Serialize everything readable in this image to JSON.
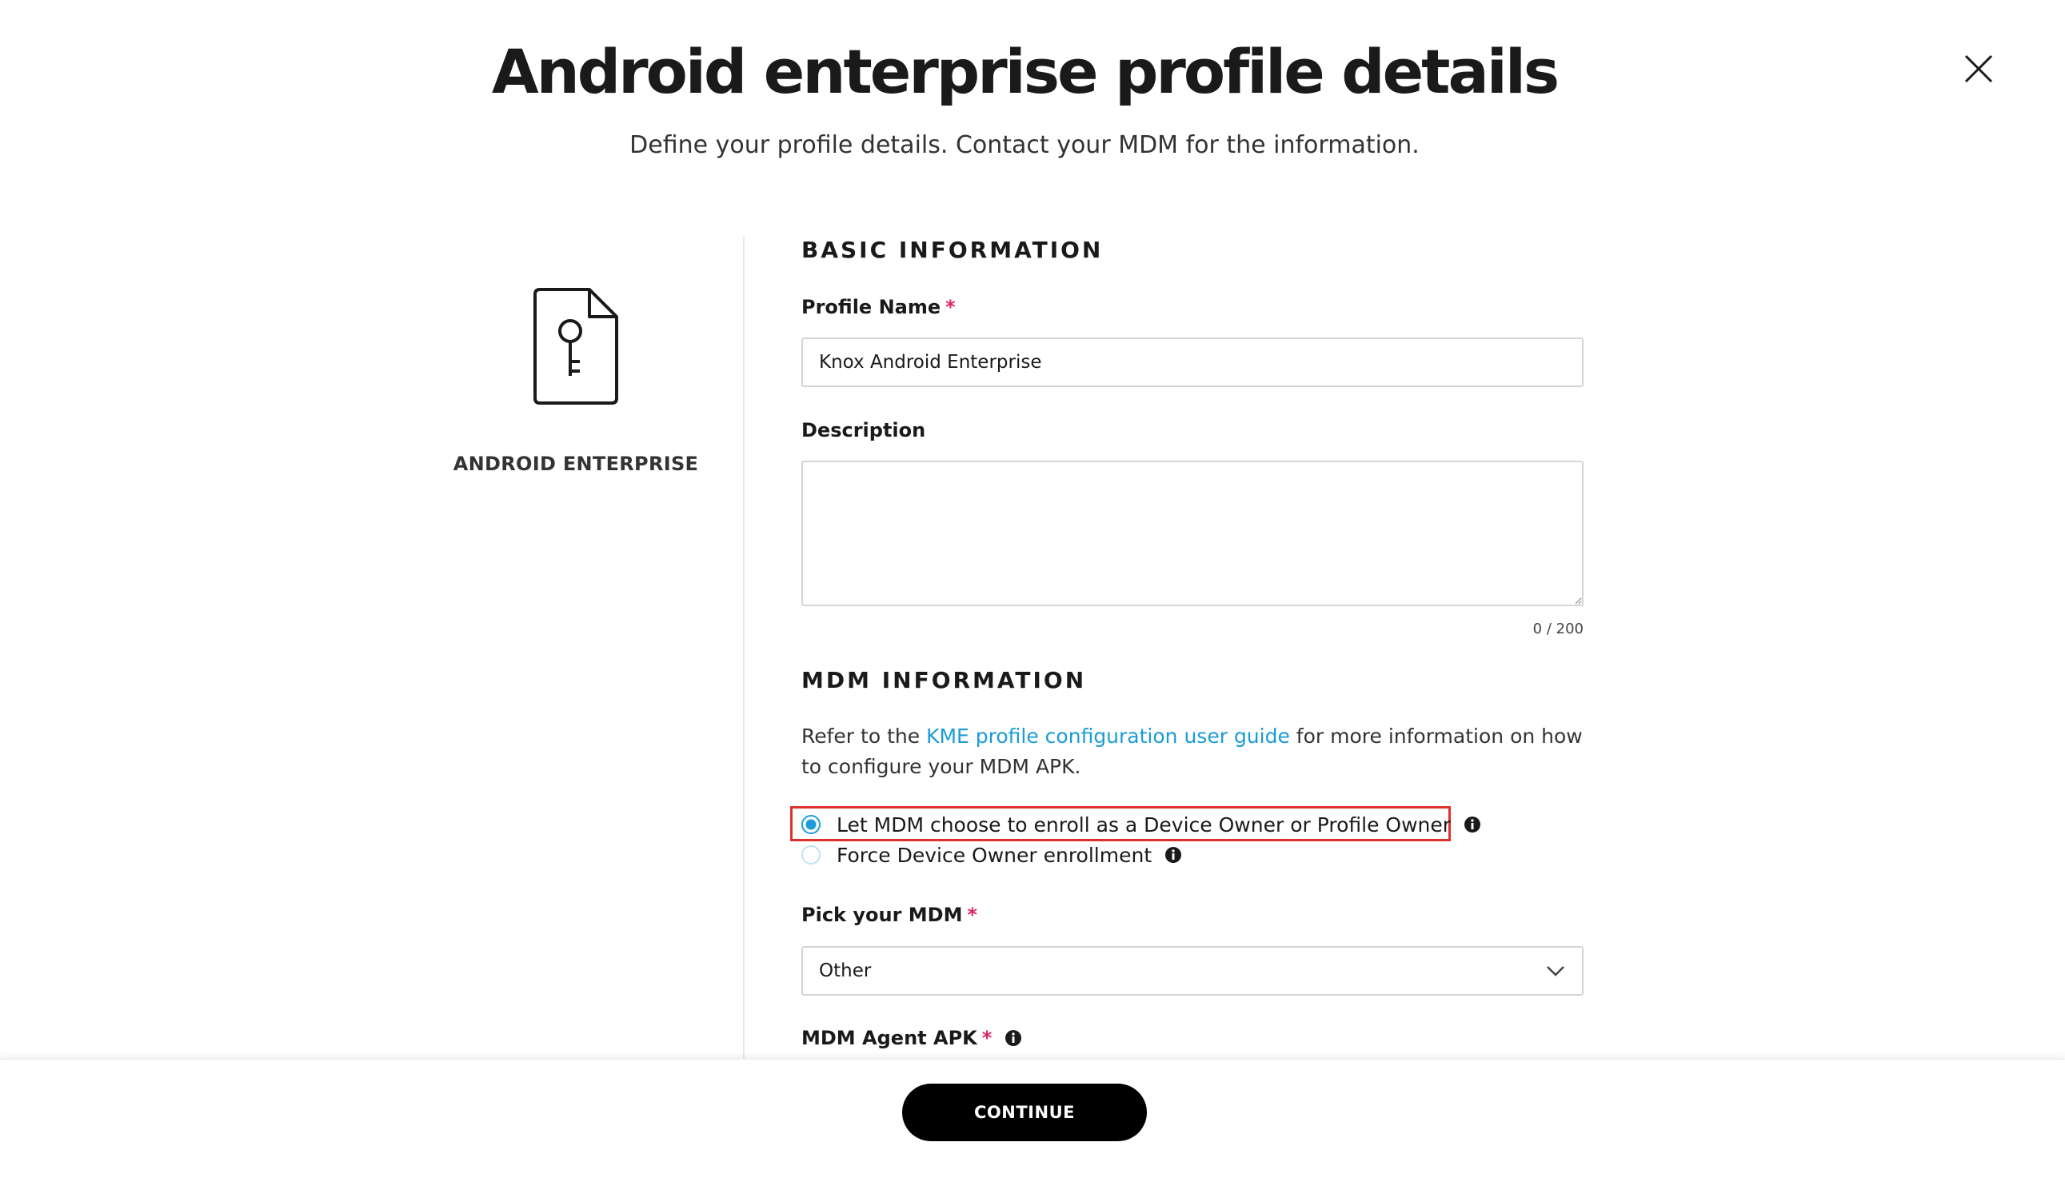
{
  "header": {
    "title": "Android enterprise profile details",
    "subtitle": "Define your profile details. Contact your MDM for the information.",
    "close_icon": "close-icon"
  },
  "left_panel": {
    "icon": "document-key-icon",
    "label": "ANDROID ENTERPRISE"
  },
  "basic_information": {
    "section_title": "BASIC INFORMATION",
    "profile_name": {
      "label": "Profile Name",
      "required_mark": "*",
      "value": "Knox Android Enterprise"
    },
    "description": {
      "label": "Description",
      "value": "",
      "counter": "0 / 200"
    }
  },
  "mdm_information": {
    "section_title": "MDM INFORMATION",
    "info_prefix": "Refer to the ",
    "info_link": "KME profile configuration user guide",
    "info_suffix": " for more information on how to configure your MDM APK.",
    "radio_options": [
      {
        "label": "Let MDM choose to enroll as a Device Owner or Profile Owner",
        "selected": true
      },
      {
        "label": "Force Device Owner enrollment",
        "selected": false
      }
    ],
    "pick_mdm": {
      "label": "Pick your MDM",
      "required_mark": "*",
      "value": "Other"
    },
    "agent_apk": {
      "label": "MDM Agent APK",
      "required_mark": "*"
    }
  },
  "footer": {
    "continue_label": "CONTINUE"
  },
  "colors": {
    "accent": "#1a9cd8",
    "required": "#e0245e",
    "highlight_border": "#e0302c",
    "button_bg": "#000000"
  }
}
